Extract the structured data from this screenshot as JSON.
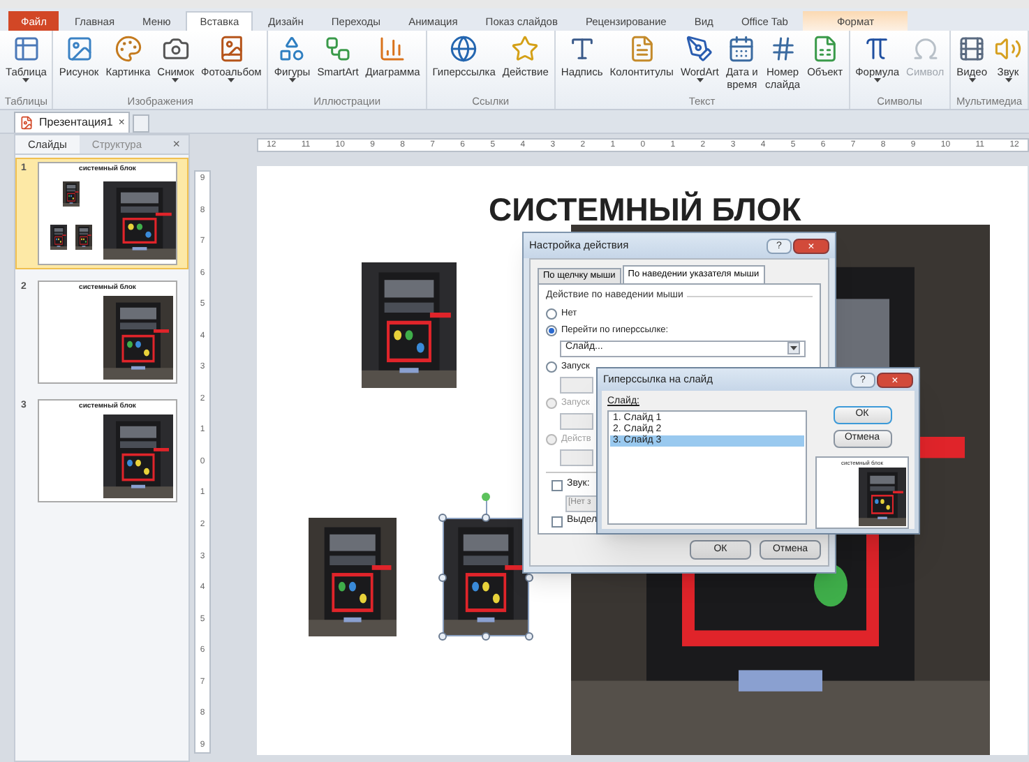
{
  "ribbon_tabs": [
    {
      "label": "Файл",
      "kind": "file",
      "selected": false
    },
    {
      "label": "Главная",
      "kind": "tab",
      "selected": false
    },
    {
      "label": "Меню",
      "kind": "tab",
      "selected": false
    },
    {
      "label": "Вставка",
      "kind": "tab",
      "selected": true
    },
    {
      "label": "Дизайн",
      "kind": "tab",
      "selected": false
    },
    {
      "label": "Переходы",
      "kind": "tab",
      "selected": false
    },
    {
      "label": "Анимация",
      "kind": "tab",
      "selected": false
    },
    {
      "label": "Показ слайдов",
      "kind": "tab",
      "selected": false
    },
    {
      "label": "Рецензирование",
      "kind": "tab",
      "selected": false
    },
    {
      "label": "Вид",
      "kind": "tab",
      "selected": false
    },
    {
      "label": "Office Tab",
      "kind": "tab",
      "selected": false
    },
    {
      "label": "Формат",
      "kind": "contextual",
      "selected": false
    }
  ],
  "ribbon_groups": [
    {
      "label": "Таблицы",
      "buttons": [
        {
          "label": "Таблица",
          "dropdown": true,
          "disabled": false
        }
      ]
    },
    {
      "label": "Изображения",
      "buttons": [
        {
          "label": "Рисунок",
          "dropdown": false,
          "disabled": false
        },
        {
          "label": "Картинка",
          "dropdown": false,
          "disabled": false
        },
        {
          "label": "Снимок",
          "dropdown": true,
          "disabled": false
        },
        {
          "label": "Фотоальбом",
          "dropdown": true,
          "disabled": false
        }
      ]
    },
    {
      "label": "Иллюстрации",
      "buttons": [
        {
          "label": "Фигуры",
          "dropdown": true,
          "disabled": false
        },
        {
          "label": "SmartArt",
          "dropdown": false,
          "disabled": false
        },
        {
          "label": "Диаграмма",
          "dropdown": false,
          "disabled": false
        }
      ]
    },
    {
      "label": "Ссылки",
      "buttons": [
        {
          "label": "Гиперссылка",
          "dropdown": false,
          "disabled": false
        },
        {
          "label": "Действие",
          "dropdown": false,
          "disabled": false
        }
      ]
    },
    {
      "label": "Текст",
      "buttons": [
        {
          "label": "Надпись",
          "dropdown": false,
          "disabled": false
        },
        {
          "label": "Колонтитулы",
          "dropdown": false,
          "disabled": false
        },
        {
          "label": "WordArt",
          "dropdown": true,
          "disabled": false
        },
        {
          "label": "Дата и время",
          "dropdown": false,
          "disabled": false
        },
        {
          "label": "Номер слайда",
          "dropdown": false,
          "disabled": false
        },
        {
          "label": "Объект",
          "dropdown": false,
          "disabled": false
        }
      ]
    },
    {
      "label": "Символы",
      "buttons": [
        {
          "label": "Формула",
          "dropdown": true,
          "disabled": false
        },
        {
          "label": "Символ",
          "dropdown": false,
          "disabled": true
        }
      ]
    },
    {
      "label": "Мультимедиа",
      "buttons": [
        {
          "label": "Видео",
          "dropdown": true,
          "disabled": false
        },
        {
          "label": "Звук",
          "dropdown": true,
          "disabled": false
        }
      ]
    }
  ],
  "document_tabs": [
    {
      "label": "Презентация1",
      "close": "×",
      "selected": true
    }
  ],
  "slides_panel": {
    "tabs": [
      {
        "label": "Слайды",
        "selected": true
      },
      {
        "label": "Структура",
        "selected": false
      }
    ],
    "close": "×",
    "thumbnails": [
      {
        "number": "1",
        "title": "системный блок",
        "kind": "collage",
        "selected": true
      },
      {
        "number": "2",
        "title": "системный блок",
        "kind": "single",
        "selected": false
      },
      {
        "number": "3",
        "title": "системный блок",
        "kind": "single",
        "selected": false
      }
    ]
  },
  "rulers": {
    "horizontal": [
      "12",
      "11",
      "10",
      "9",
      "8",
      "7",
      "6",
      "5",
      "4",
      "3",
      "2",
      "1",
      "0",
      "1",
      "2",
      "3",
      "4",
      "5",
      "6",
      "7",
      "8",
      "9",
      "10",
      "11",
      "12"
    ],
    "vertical": [
      "9",
      "8",
      "7",
      "6",
      "5",
      "4",
      "3",
      "2",
      "1",
      "0",
      "1",
      "2",
      "3",
      "4",
      "5",
      "6",
      "7",
      "8",
      "9"
    ]
  },
  "slide": {
    "title": "СИСТЕМНЫЙ БЛОК",
    "pictures": [
      {
        "kind": "picture",
        "selected": false
      },
      {
        "kind": "picture",
        "selected": false
      },
      {
        "kind": "picture",
        "selected": true
      },
      {
        "kind": "picture",
        "selected": false
      }
    ]
  },
  "action_dialog": {
    "title": "Настройка действия",
    "help": "?",
    "close": "×",
    "tabs": [
      {
        "label": "По щелчку мыши",
        "selected": false
      },
      {
        "label": "По наведении указателя мыши",
        "selected": true
      }
    ],
    "group_label": "Действие по наведении мыши",
    "options": [
      {
        "label": "Нет",
        "selected": false,
        "disabled": false
      },
      {
        "label": "Перейти по гиперссылке:",
        "selected": true,
        "disabled": false,
        "field": {
          "kind": "dropdown",
          "value": "Слайд..."
        }
      },
      {
        "label": "Запуск",
        "selected": false,
        "disabled": false,
        "field": {
          "kind": "box"
        }
      },
      {
        "label": "Запуск",
        "selected": false,
        "disabled": true,
        "field": {
          "kind": "box"
        }
      },
      {
        "label": "Действ",
        "selected": false,
        "disabled": true,
        "field": {
          "kind": "box"
        }
      }
    ],
    "checkboxes": [
      {
        "label": "Звук:",
        "checked": false,
        "field": {
          "kind": "box",
          "value": "[Нет з"
        }
      },
      {
        "label": "Выдел",
        "checked": false
      }
    ],
    "buttons": [
      "ОК",
      "Отмена"
    ]
  },
  "link_dialog": {
    "title": "Гиперссылка на слайд",
    "help": "?",
    "close": "×",
    "list_label": "Слайд:",
    "slides": [
      {
        "label": "1. Слайд 1",
        "selected": false
      },
      {
        "label": "2. Слайд 2",
        "selected": false
      },
      {
        "label": "3. Слайд 3",
        "selected": true
      }
    ],
    "buttons": [
      "ОК",
      "Отмена"
    ],
    "preview_title": "системный блок"
  }
}
